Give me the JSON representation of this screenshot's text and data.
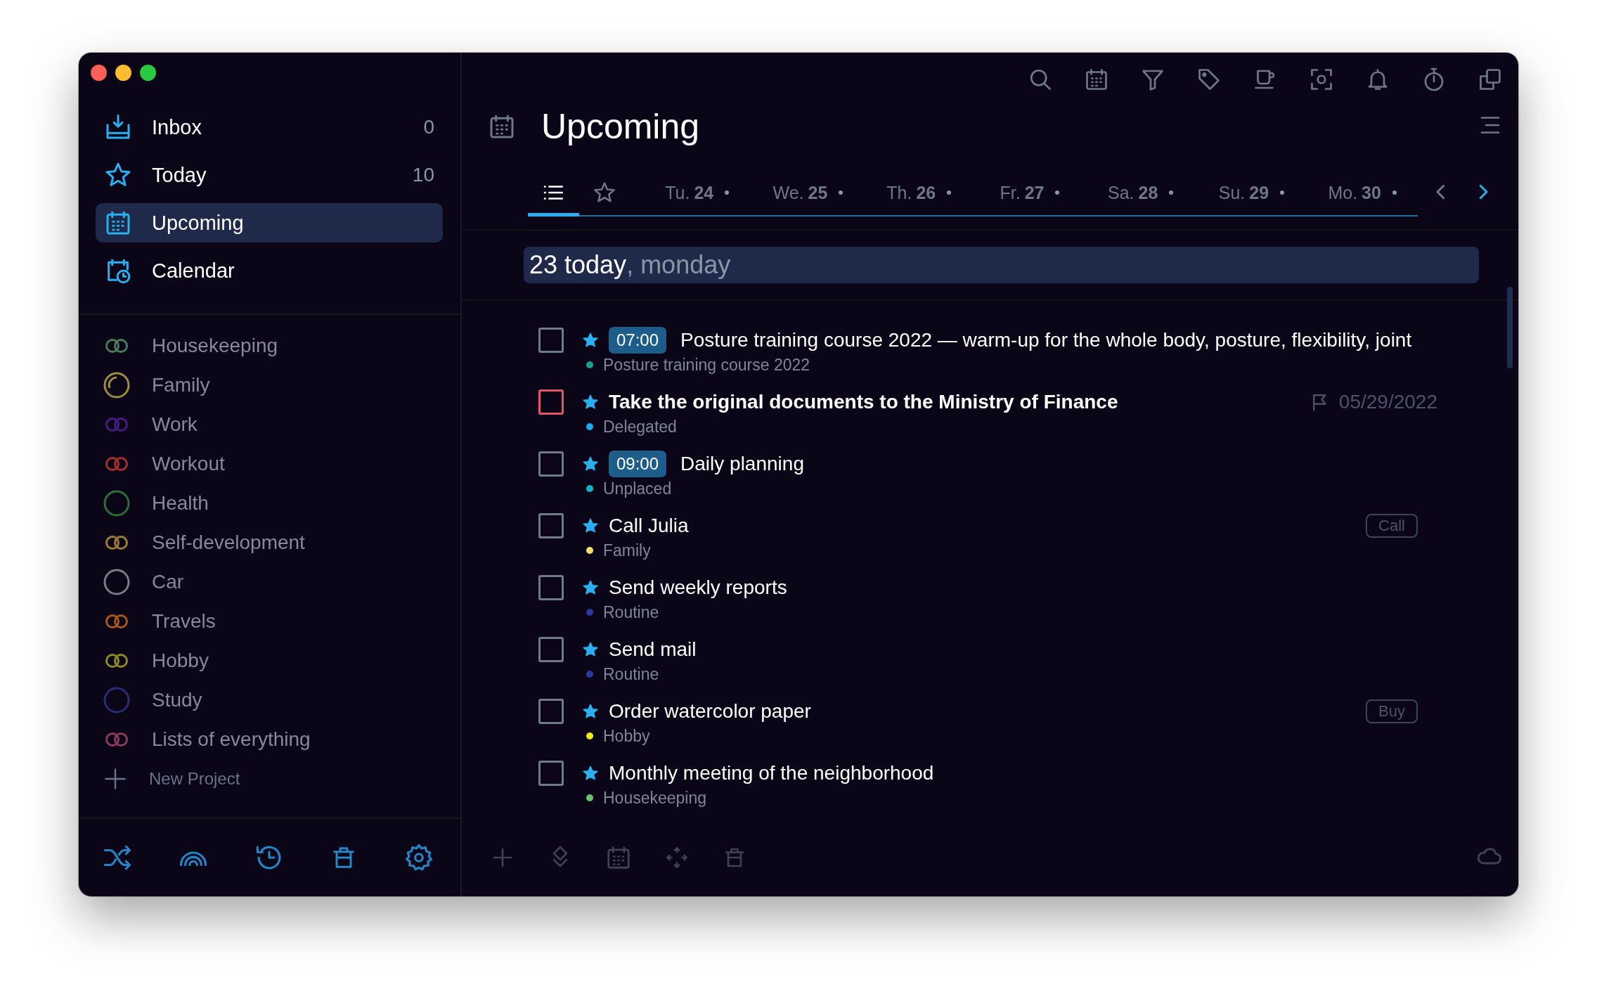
{
  "sidebar": {
    "nav": [
      {
        "kind": "inbox",
        "label": "Inbox",
        "count": "0",
        "selected": false
      },
      {
        "kind": "today",
        "label": "Today",
        "count": "10",
        "selected": false
      },
      {
        "kind": "upcoming",
        "label": "Upcoming",
        "selected": true
      },
      {
        "kind": "calendar",
        "label": "Calendar",
        "selected": false
      }
    ],
    "projects": [
      {
        "kind": "linked",
        "label": "Housekeeping",
        "color": "#4e7a5c"
      },
      {
        "kind": "progress",
        "label": "Family",
        "color": "#a08c3e"
      },
      {
        "kind": "linked",
        "label": "Work",
        "color": "#4b1a86"
      },
      {
        "kind": "linked",
        "label": "Workout",
        "color": "#a3302f"
      },
      {
        "kind": "circle",
        "label": "Health",
        "color": "#2f6e3b"
      },
      {
        "kind": "linked",
        "label": "Self-development",
        "color": "#9c7b32"
      },
      {
        "kind": "circle",
        "label": "Car",
        "color": "#7c7b84"
      },
      {
        "kind": "linked",
        "label": "Travels",
        "color": "#a6581c"
      },
      {
        "kind": "linked",
        "label": "Hobby",
        "color": "#8c8a22"
      },
      {
        "kind": "circle",
        "label": "Study",
        "color": "#2c2c74"
      },
      {
        "kind": "linked",
        "label": "Lists of everything",
        "color": "#8c3a5c"
      }
    ],
    "new_project": "New Project"
  },
  "main": {
    "title": "Upcoming",
    "tabs": [
      {
        "kind": "list",
        "selected": true
      },
      {
        "kind": "starred",
        "selected": false
      },
      {
        "kind": "day",
        "weekday": "Tu.",
        "day": "24",
        "selected": false
      },
      {
        "kind": "day",
        "weekday": "We.",
        "day": "25",
        "selected": false
      },
      {
        "kind": "day",
        "weekday": "Th.",
        "day": "26",
        "selected": false
      },
      {
        "kind": "day",
        "weekday": "Fr.",
        "day": "27",
        "selected": false
      },
      {
        "kind": "day",
        "weekday": "Sa.",
        "day": "28",
        "selected": false
      },
      {
        "kind": "day",
        "weekday": "Su.",
        "day": "29",
        "selected": false
      },
      {
        "kind": "day",
        "weekday": "Mo.",
        "day": "30",
        "selected": false
      }
    ],
    "date_header": {
      "date": "23 today",
      "weekday": ", monday"
    },
    "tasks": [
      {
        "checked": false,
        "urgent": false,
        "starred": true,
        "time": "07:00",
        "title": "Posture training course 2022 — warm-up for the whole body, posture, flexibility, joint",
        "project": "Posture training course 2022",
        "color": "#18a08a"
      },
      {
        "checked": false,
        "urgent": true,
        "starred": true,
        "title": "Take the original documents to the Ministry of Finance",
        "project": "Delegated",
        "color": "#1ea8f0",
        "due": "05/29/2022"
      },
      {
        "checked": false,
        "urgent": false,
        "starred": true,
        "time": "09:00",
        "title": "Daily planning",
        "project": "Unplaced",
        "color": "#18b0c8"
      },
      {
        "checked": false,
        "urgent": false,
        "starred": true,
        "title": "Call Julia",
        "project": "Family",
        "color": "#f4e06a",
        "tag": "Call"
      },
      {
        "checked": false,
        "urgent": false,
        "starred": true,
        "title": "Send weekly reports",
        "project": "Routine",
        "color": "#2c3a9c"
      },
      {
        "checked": false,
        "urgent": false,
        "starred": true,
        "title": "Send mail",
        "project": "Routine",
        "color": "#2c3a9c"
      },
      {
        "checked": false,
        "urgent": false,
        "starred": true,
        "title": "Order watercolor paper",
        "project": "Hobby",
        "color": "#f0e81a",
        "tag": "Buy"
      },
      {
        "checked": false,
        "urgent": false,
        "starred": true,
        "title": "Monthly meeting of the neighborhood",
        "project": "Housekeeping",
        "color": "#6cc070"
      }
    ]
  }
}
